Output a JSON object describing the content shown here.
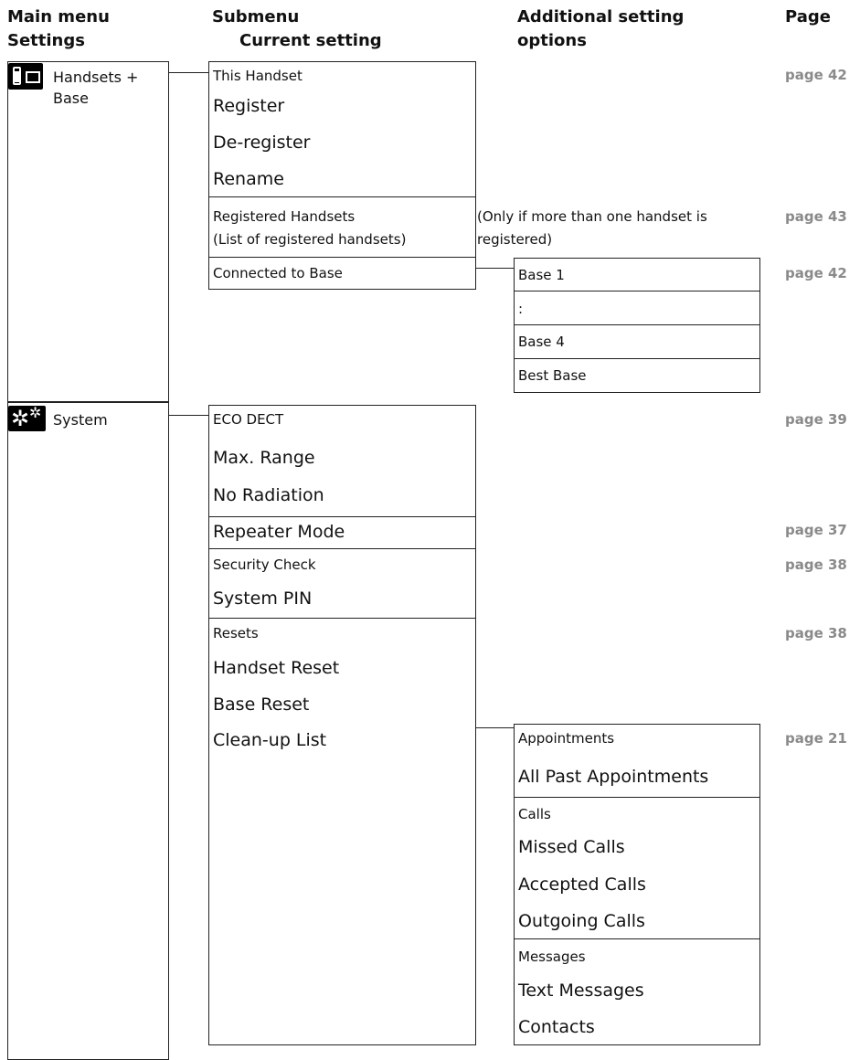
{
  "headers": {
    "main_menu": "Main menu",
    "settings": "Settings",
    "submenu": "Submenu",
    "current_setting": "Current setting",
    "additional_line1": "Additional setting",
    "additional_line2": "options",
    "page": "Page"
  },
  "main": {
    "handsets_line1": "Handsets +",
    "handsets_line2": "Base",
    "handsets_icon": "handset-base-icon",
    "system": "System",
    "system_icon": "gears-icon"
  },
  "handsets_group": {
    "this_handset": "This Handset",
    "register": "Register",
    "deregister": "De-register",
    "rename": "Rename",
    "registered_handsets": "Registered Handsets",
    "registered_list": "(List of registered handsets)",
    "registered_note_line1": "(Only if more than one handset is",
    "registered_note_line2": "registered)",
    "connected_to_base": "Connected to Base",
    "base_options": [
      "Base 1",
      ":",
      "Base 4",
      "Best Base"
    ]
  },
  "system_group": {
    "eco_dect": "ECO DECT",
    "max_range": "Max. Range",
    "no_radiation": "No Radiation",
    "repeater_mode": "Repeater Mode",
    "security_check": "Security Check",
    "system_pin": "System PIN",
    "resets": "Resets",
    "handset_reset": "Handset Reset",
    "base_reset": "Base Reset",
    "cleanup_list": "Clean-up List",
    "cleanup": {
      "appointments": "Appointments",
      "all_past_appointments": "All Past Appointments",
      "calls": "Calls",
      "missed_calls": "Missed Calls",
      "accepted_calls": "Accepted Calls",
      "outgoing_calls": "Outgoing Calls",
      "messages": "Messages",
      "text_messages": "Text Messages",
      "contacts": "Contacts"
    }
  },
  "pages": {
    "this_handset": "page 42",
    "registered_handsets": "page 43",
    "connected_to_base": "page 42",
    "eco_dect": "page 39",
    "repeater_mode": "page 37",
    "security_check": "page 38",
    "resets": "page 38",
    "appointments": "page 21"
  },
  "colors": {
    "page_ref": "#8a8a8a",
    "line": "#222222"
  }
}
